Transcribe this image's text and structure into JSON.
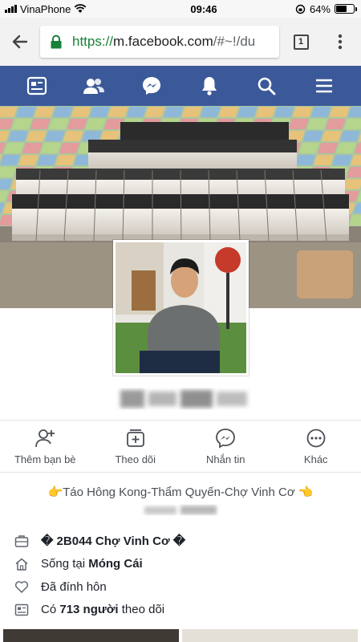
{
  "status_bar": {
    "carrier": "VinaPhone",
    "time": "09:46",
    "battery_percent": "64%",
    "battery_level": 0.64
  },
  "browser": {
    "url_scheme": "https://",
    "url_host": "m.facebook.com",
    "url_path": "/#~!/du",
    "tab_count": "1"
  },
  "fb_nav": {
    "items": [
      {
        "icon": "news-feed-icon"
      },
      {
        "icon": "friends-icon"
      },
      {
        "icon": "messenger-icon"
      },
      {
        "icon": "notifications-bell-icon"
      },
      {
        "icon": "search-icon"
      },
      {
        "icon": "menu-icon"
      }
    ],
    "bg_color": "#3b5998"
  },
  "actions": [
    {
      "label": "Thêm bạn bè",
      "icon": "add-friend-icon"
    },
    {
      "label": "Theo dõi",
      "icon": "follow-icon"
    },
    {
      "label": "Nhắn tin",
      "icon": "messenger-icon"
    },
    {
      "label": "Khác",
      "icon": "more-icon"
    }
  ],
  "intro": {
    "text": "👉Táo Hông Kong-Thẩm Quyến-Chợ Vinh Cơ 👈"
  },
  "details": {
    "work": {
      "value": "� 2B044 Chợ Vinh Cơ �"
    },
    "lives_prefix": "Sống tại ",
    "lives_place": "Móng Cái",
    "relationship": "Đã đính hôn",
    "followers_prefix": "Có ",
    "followers_count": "713 người",
    "followers_suffix": " theo dõi"
  }
}
